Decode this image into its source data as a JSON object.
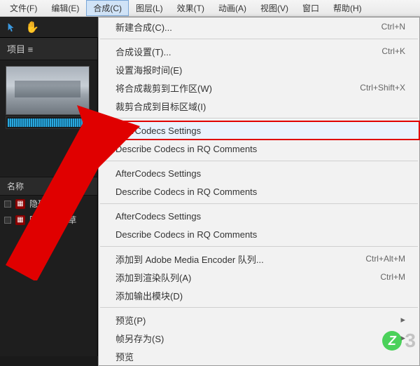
{
  "menubar": {
    "items": [
      {
        "label": "文件(F)"
      },
      {
        "label": "编辑(E)"
      },
      {
        "label": "合成(C)"
      },
      {
        "label": "图层(L)"
      },
      {
        "label": "效果(T)"
      },
      {
        "label": "动画(A)"
      },
      {
        "label": "视图(V)"
      },
      {
        "label": "窗口"
      },
      {
        "label": "帮助(H)"
      }
    ],
    "active_index": 2
  },
  "project_panel": {
    "title": "项目 ≡",
    "name_header": "名称",
    "assets": [
      {
        "label": "隐形人 (音乐"
      },
      {
        "label": "陌路人 (香草"
      }
    ]
  },
  "dropdown": {
    "items": [
      {
        "label": "新建合成(C)...",
        "shortcut": "Ctrl+N"
      },
      {
        "type": "separator"
      },
      {
        "label": "合成设置(T)...",
        "shortcut": "Ctrl+K"
      },
      {
        "label": "设置海报时间(E)"
      },
      {
        "label": "将合成裁剪到工作区(W)",
        "shortcut": "Ctrl+Shift+X"
      },
      {
        "label": "裁剪合成到目标区域(I)"
      },
      {
        "type": "separator"
      },
      {
        "label": "AfterCodecs Settings",
        "highlight": true
      },
      {
        "label": "Describe Codecs in RQ Comments"
      },
      {
        "type": "separator"
      },
      {
        "label": "AfterCodecs Settings"
      },
      {
        "label": "Describe Codecs in RQ Comments"
      },
      {
        "type": "separator"
      },
      {
        "label": "AfterCodecs Settings"
      },
      {
        "label": "Describe Codecs in RQ Comments"
      },
      {
        "type": "separator"
      },
      {
        "label": "添加到 Adobe Media Encoder 队列...",
        "shortcut": "Ctrl+Alt+M"
      },
      {
        "label": "添加到渲染队列(A)",
        "shortcut": "Ctrl+M"
      },
      {
        "label": "添加输出模块(D)"
      },
      {
        "type": "separator"
      },
      {
        "label": "预览(P)",
        "submenu": true
      },
      {
        "label": "帧另存为(S)",
        "submenu": true
      },
      {
        "label": "预览"
      }
    ]
  },
  "watermark": {
    "letter": "Z",
    "num": "3"
  }
}
